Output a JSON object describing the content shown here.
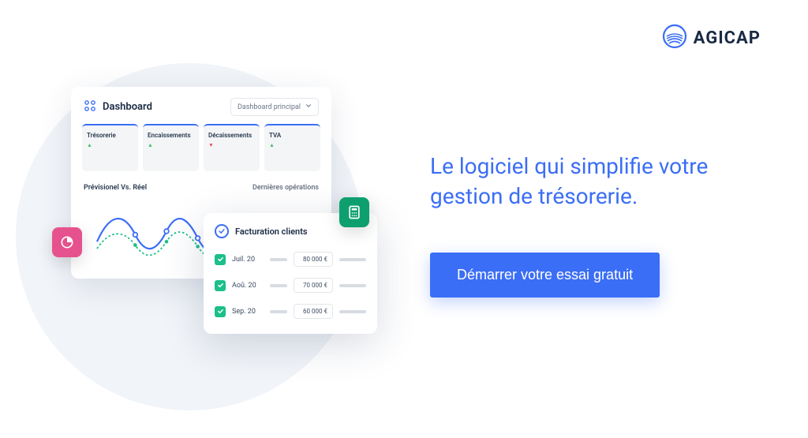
{
  "brand": {
    "name": "AGICAP"
  },
  "dashboard": {
    "title": "Dashboard",
    "dropdown": "Dashboard principal",
    "tiles": [
      {
        "label": "Trésorerie",
        "ind": "▲"
      },
      {
        "label": "Encaissements",
        "ind": "▲"
      },
      {
        "label": "Décaissements",
        "ind": "▼"
      },
      {
        "label": "TVA",
        "ind": "▲"
      }
    ],
    "sub_left": "Prévisionel Vs. Réel",
    "sub_right": "Dernières opérations"
  },
  "facturation": {
    "title": "Facturation clients",
    "rows": [
      {
        "month": "Juil. 20",
        "amount": "80 000 €"
      },
      {
        "month": "Aoû. 20",
        "amount": "70 000 €"
      },
      {
        "month": "Sep. 20",
        "amount": "60 000 €"
      }
    ]
  },
  "hero": {
    "headline": "Le logiciel qui simplifie votre gestion de trésorerie.",
    "cta": "Démarrer votre essai gratuit"
  }
}
